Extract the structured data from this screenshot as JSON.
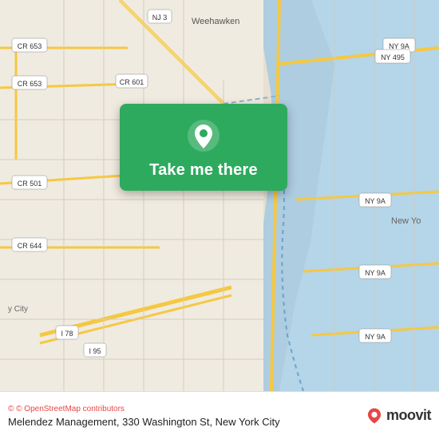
{
  "map": {
    "alt": "Map showing Melendez Management location in New York City area"
  },
  "location_card": {
    "button_label": "Take me there",
    "pin_icon": "location-pin"
  },
  "bottom_bar": {
    "osm_credit": "© OpenStreetMap contributors",
    "location_text": "Melendez Management, 330 Washington St, New York City",
    "logo_text": "moovit"
  },
  "road_labels": [
    "CR 653",
    "CR 653",
    "CR 601",
    "CR 501",
    "CR 644",
    "NJ 3",
    "NY 9A",
    "NY 495",
    "NY 9A",
    "NY 9A",
    "NY 9A",
    "I 78",
    "I 95",
    "Weehawken",
    "New Yo"
  ]
}
